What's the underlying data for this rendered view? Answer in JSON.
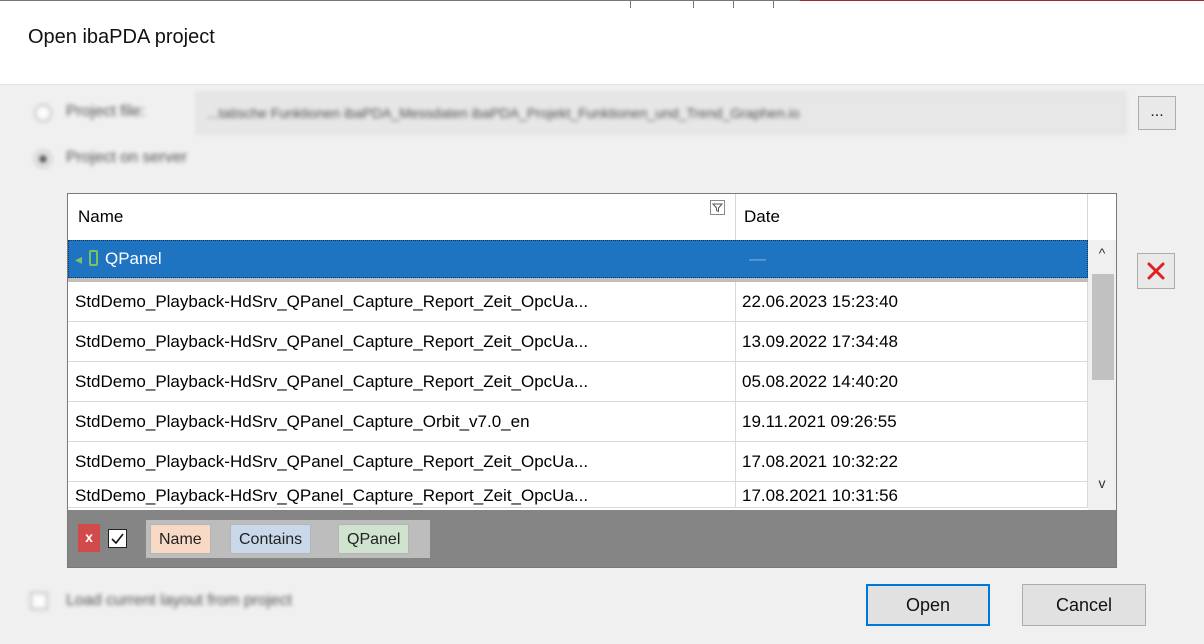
{
  "dialog": {
    "title": "Open ibaPDA project"
  },
  "source": {
    "project_file_label": "Project file:",
    "project_file_path": "...tatische Funktionen ibaPDA_Messdaten ibaPDA_Projekt_Funktionen_und_Trend_Graphen.io",
    "browse_label": "...",
    "project_on_server_label": "Project on server",
    "selected": "project_on_server"
  },
  "grid": {
    "columns": [
      "Name",
      "Date"
    ],
    "group": {
      "label": "QPanel",
      "date": "—"
    },
    "rows": [
      {
        "name": "StdDemo_Playback-HdSrv_QPanel_Capture_Report_Zeit_OpcUa...",
        "date": "22.06.2023 15:23:40"
      },
      {
        "name": "StdDemo_Playback-HdSrv_QPanel_Capture_Report_Zeit_OpcUa...",
        "date": "13.09.2022 17:34:48"
      },
      {
        "name": "StdDemo_Playback-HdSrv_QPanel_Capture_Report_Zeit_OpcUa...",
        "date": "05.08.2022 14:40:20"
      },
      {
        "name": "StdDemo_Playback-HdSrv_QPanel_Capture_Orbit_v7.0_en",
        "date": "19.11.2021 09:26:55"
      },
      {
        "name": "StdDemo_Playback-HdSrv_QPanel_Capture_Report_Zeit_OpcUa...",
        "date": "17.08.2021 10:32:22"
      },
      {
        "name": "StdDemo_Playback-HdSrv_QPanel_Capture_Report_Zeit_OpcUa...",
        "date": "17.08.2021 10:31:56"
      }
    ],
    "scroll_up": "^",
    "scroll_down": "v"
  },
  "filter": {
    "clear_label": "x",
    "enabled": true,
    "field": "Name",
    "operator": "Contains",
    "value": "QPanel"
  },
  "footer": {
    "load_layout_label": "Load current layout from project",
    "open_label": "Open",
    "cancel_label": "Cancel"
  },
  "colors": {
    "selection": "#1e74c1",
    "delete_icon": "#e02020",
    "focus_border": "#0078d7"
  }
}
